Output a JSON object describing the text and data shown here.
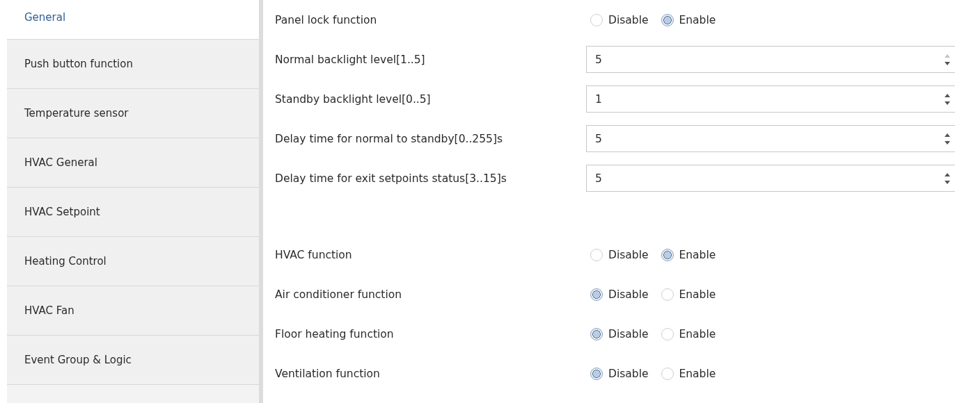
{
  "sidebar": {
    "items": [
      {
        "label": "General",
        "selected": true
      },
      {
        "label": "Push button function",
        "selected": false
      },
      {
        "label": "Temperature sensor",
        "selected": false
      },
      {
        "label": "HVAC General",
        "selected": false
      },
      {
        "label": "HVAC Setpoint",
        "selected": false
      },
      {
        "label": "Heating Control",
        "selected": false
      },
      {
        "label": "HVAC Fan",
        "selected": false
      },
      {
        "label": "Event Group & Logic",
        "selected": false
      }
    ]
  },
  "sections": [
    {
      "rows": [
        {
          "kind": "radio",
          "label": "Panel lock function",
          "options": [
            {
              "label": "Disable",
              "selected": false
            },
            {
              "label": "Enable",
              "selected": true
            }
          ]
        },
        {
          "kind": "number",
          "label": "Normal backlight level[1..5]",
          "value": "5",
          "up_disabled": true
        },
        {
          "kind": "number",
          "label": "Standby backlight level[0..5]",
          "value": "1",
          "up_disabled": false
        },
        {
          "kind": "number",
          "label": "Delay time for normal to standby[0..255]s",
          "value": "5",
          "up_disabled": false
        },
        {
          "kind": "number",
          "label": "Delay time for exit setpoints status[3..15]s",
          "value": "5",
          "up_disabled": false
        }
      ]
    },
    {
      "rows": [
        {
          "kind": "radio",
          "label": "HVAC function",
          "options": [
            {
              "label": "Disable",
              "selected": false
            },
            {
              "label": "Enable",
              "selected": true
            }
          ]
        },
        {
          "kind": "radio",
          "label": "Air conditioner function",
          "options": [
            {
              "label": "Disable",
              "selected": true
            },
            {
              "label": "Enable",
              "selected": false
            }
          ]
        },
        {
          "kind": "radio",
          "label": "Floor heating function",
          "options": [
            {
              "label": "Disable",
              "selected": true
            },
            {
              "label": "Enable",
              "selected": false
            }
          ]
        },
        {
          "kind": "radio",
          "label": "Ventilation function",
          "options": [
            {
              "label": "Disable",
              "selected": true
            },
            {
              "label": "Enable",
              "selected": false
            }
          ]
        }
      ]
    }
  ]
}
